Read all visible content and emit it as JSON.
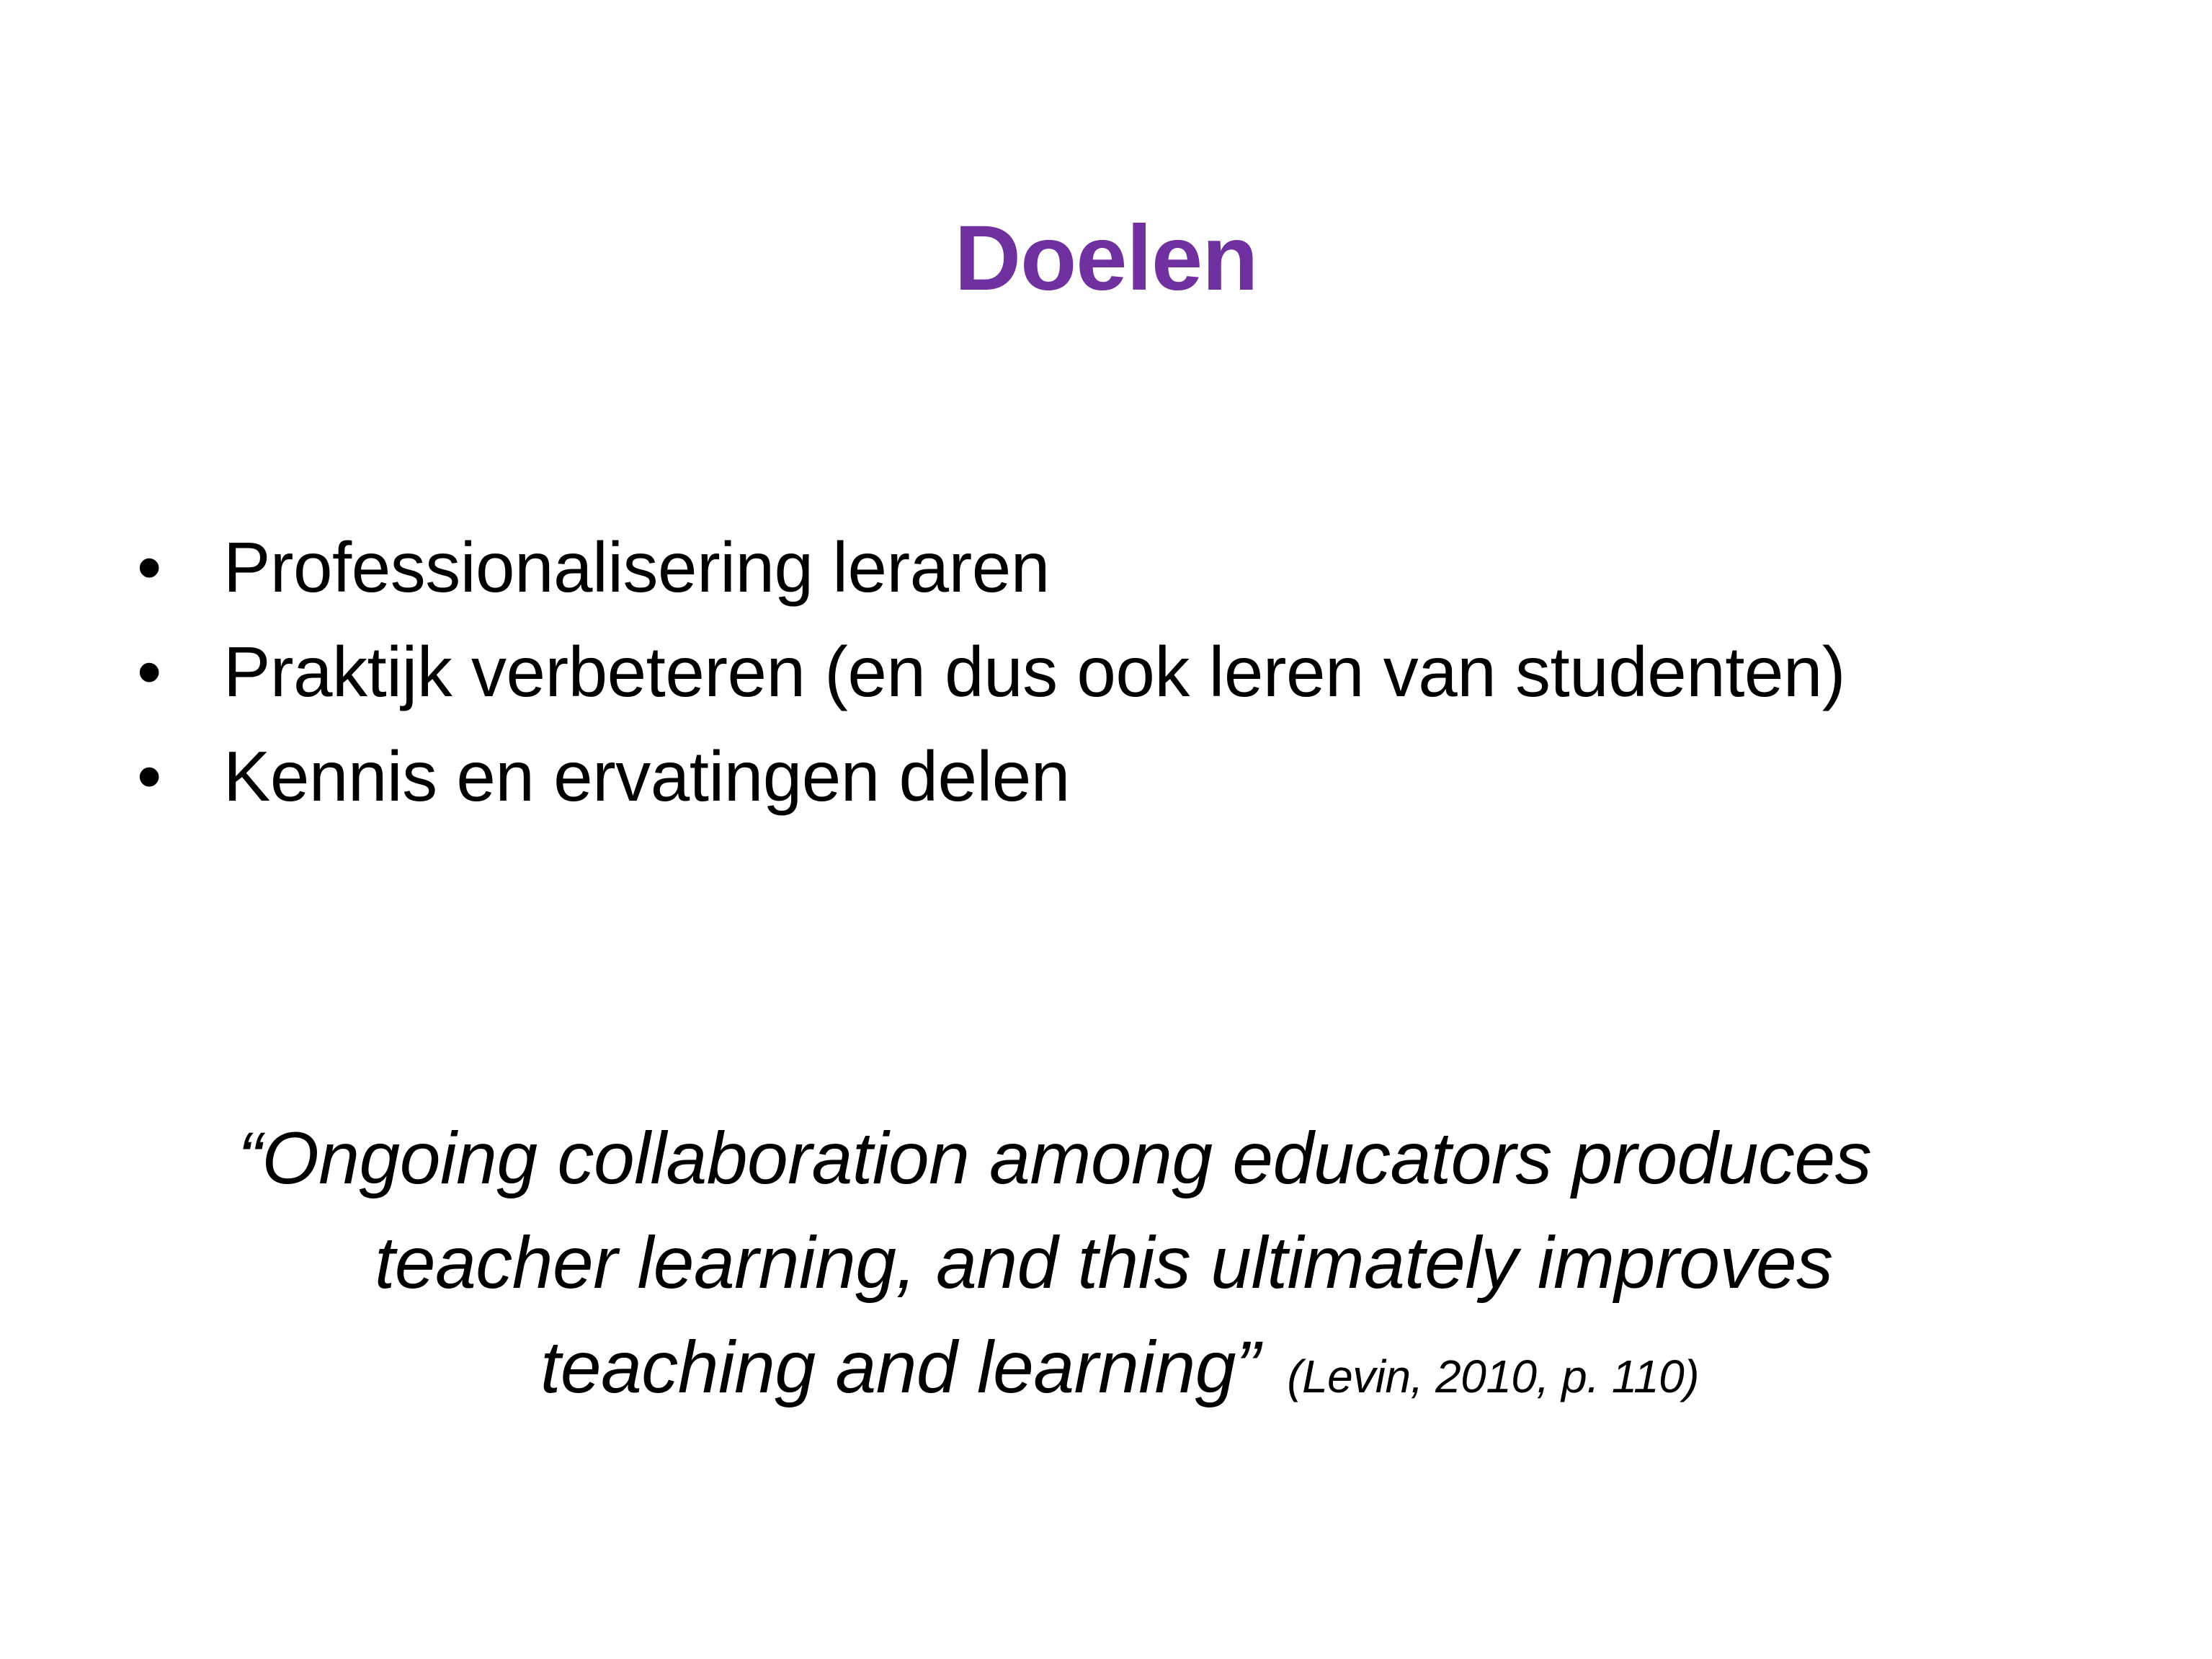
{
  "slide": {
    "title": "Doelen",
    "title_color": "#7030A0",
    "bullet_symbol": "•",
    "bullets": [
      "Professionalisering leraren",
      "Praktijk verbeteren (en dus ook leren van studenten)",
      "Kennis en ervatingen delen"
    ],
    "quote": {
      "lines": [
        "“Ongoing collaboration among educators produces",
        "teacher learning, and this ultimately improves",
        "teaching and learning”"
      ],
      "citation": "(Levin, 2010, p. 110)"
    }
  }
}
